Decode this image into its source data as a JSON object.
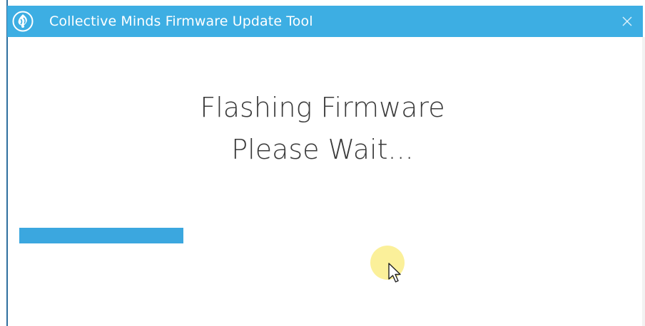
{
  "window": {
    "title": "Collective Minds Firmware Update Tool",
    "accent_color": "#3daee3"
  },
  "titlebar": {
    "logo_icon": "collective-minds-logo-icon",
    "close_icon": "close-icon"
  },
  "status": {
    "line1": "Flashing Firmware",
    "line2": "Please Wait..."
  },
  "progress": {
    "fraction": 0.27,
    "color": "#3ba7df"
  },
  "cursor": {
    "icon": "mouse-pointer-icon",
    "highlight_color": "#fbe87a"
  }
}
